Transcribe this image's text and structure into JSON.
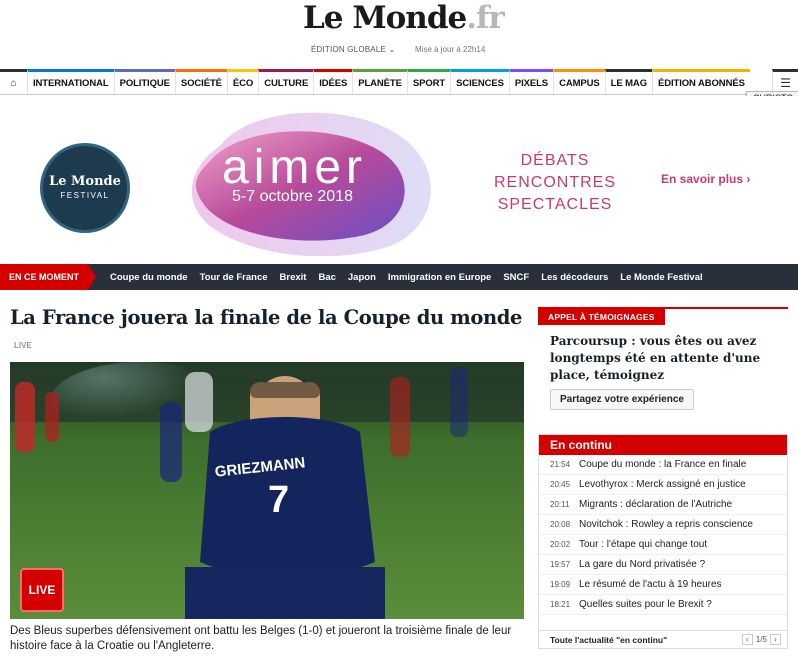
{
  "header": {
    "logo_text": "Le Monde",
    "logo_suffix": ".fr",
    "edition": "ÉDITION GLOBALE ⌄",
    "update": "Mise à jour à 22h14"
  },
  "nav": {
    "items": [
      {
        "label": "INTERNATIONAL",
        "color": "#0079c7"
      },
      {
        "label": "POLITIQUE",
        "color": "#5c6bc0"
      },
      {
        "label": "SOCIÉTÉ",
        "color": "#ff6b00"
      },
      {
        "label": "ÉCO",
        "color": "#f4c700"
      },
      {
        "label": "CULTURE",
        "color": "#9b1b56"
      },
      {
        "label": "IDÉES",
        "color": "#d40000"
      },
      {
        "label": "PLANÈTE",
        "color": "#5ba13a"
      },
      {
        "label": "SPORT",
        "color": "#2ea84f"
      },
      {
        "label": "SCIENCES",
        "color": "#00a1e0"
      },
      {
        "label": "PIXELS",
        "color": "#7c4dff"
      },
      {
        "label": "CAMPUS",
        "color": "#ff8f00"
      },
      {
        "label": "LE MAG",
        "color": "#2a303b"
      },
      {
        "label": "ÉDITION ABONNÉS",
        "color": "#f0b400"
      }
    ],
    "tooltip": "CHRISTO"
  },
  "banner": {
    "festival_title": "Le Monde",
    "festival_sub": "FESTIVAL",
    "aimer": "aimer",
    "dates": "5-7 octobre 2018",
    "debats": [
      "DÉBATS",
      "RENCONTRES",
      "SPECTACLES"
    ],
    "cta": "En savoir plus ›"
  },
  "moment": {
    "tag": "EN CE MOMENT",
    "links": [
      "Coupe du monde",
      "Tour de France",
      "Brexit",
      "Bac",
      "Japon",
      "Immigration en Europe",
      "SNCF",
      "Les décodeurs",
      "Le Monde Festival"
    ]
  },
  "article": {
    "headline": "La France jouera la finale de la Coupe du monde",
    "live_small": "LIVE",
    "jersey_name": "GRIEZMANN",
    "jersey_number": "7",
    "live_badge": "LIVE",
    "caption": "Des Bleus superbes défensivement ont battu les Belges (1-0) et joueront la troisième finale de leur histoire face à la Croatie ou l'Angleterre."
  },
  "temoignages": {
    "label": "APPEL À TÉMOIGNAGES",
    "text": "Parcoursup : vous êtes ou avez longtemps été en attente d'une place, témoignez",
    "button": "Partagez votre expérience"
  },
  "continu": {
    "title": "En continu",
    "rows": [
      {
        "time": "21:54",
        "text": "Coupe du monde : la France en finale"
      },
      {
        "time": "20:45",
        "text": "Levothyrox : Merck assigné en justice"
      },
      {
        "time": "20:11",
        "text": "Migrants : déclaration de l'Autriche"
      },
      {
        "time": "20:08",
        "text": "Novitchok : Rowley a repris conscience"
      },
      {
        "time": "20:02",
        "text": "Tour : l'étape qui change tout"
      },
      {
        "time": "19:57",
        "text": "La gare du Nord privatisée ?"
      },
      {
        "time": "19:09",
        "text": "Le résumé de l'actu à 19 heures"
      },
      {
        "time": "18:21",
        "text": "Quelles suites pour le Brexit ?"
      }
    ],
    "all_link": "Toute l'actualité \"en continu\"",
    "page": "1/5"
  }
}
